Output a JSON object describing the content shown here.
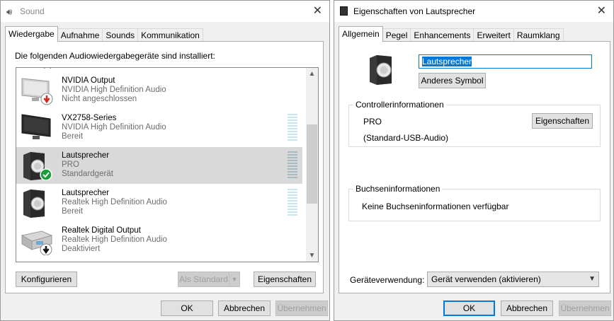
{
  "sound_window": {
    "title": "Sound",
    "tabs": [
      "Wiedergabe",
      "Aufnahme",
      "Sounds",
      "Kommunikation"
    ],
    "instruction": "Die folgenden Audiowiedergabegeräte sind installiert:",
    "devices": [
      {
        "name": "NVIDIA Output",
        "driver": "NVIDIA High Definition Audio",
        "status": "Nicht angeschlossen",
        "icon": "monitor-icon",
        "badge": "unplugged-badge-icon"
      },
      {
        "name": "VX2758-Series",
        "driver": "NVIDIA High Definition Audio",
        "status": "Bereit",
        "icon": "monitor-icon",
        "badge": ""
      },
      {
        "name": "Lautsprecher",
        "driver": "PRO",
        "status": "Standardgerät",
        "icon": "speaker-icon",
        "badge": "default-check-badge-icon"
      },
      {
        "name": "Lautsprecher",
        "driver": "Realtek High Definition Audio",
        "status": "Bereit",
        "icon": "speaker-icon",
        "badge": ""
      },
      {
        "name": "Realtek Digital Output",
        "driver": "Realtek High Definition Audio",
        "status": "Deaktiviert",
        "icon": "digital-output-icon",
        "badge": "disabled-badge-icon"
      }
    ],
    "buttons": {
      "configure": "Konfigurieren",
      "set_default": "Als Standard",
      "properties": "Eigenschaften",
      "ok": "OK",
      "cancel": "Abbrechen",
      "apply": "Übernehmen"
    }
  },
  "props_window": {
    "title": "Eigenschaften von Lautsprecher",
    "tabs": [
      "Allgemein",
      "Pegel",
      "Enhancements",
      "Erweitert",
      "Raumklang"
    ],
    "device_name": "Lautsprecher",
    "change_icon": "Anderes Symbol",
    "controller": {
      "heading": "Controllerinformationen",
      "name": "PRO",
      "detail": "(Standard-USB-Audio)",
      "properties": "Eigenschaften"
    },
    "jack": {
      "heading": "Buchseninformationen",
      "text": "Keine Buchseninformationen verfügbar"
    },
    "usage_label": "Geräteverwendung:",
    "usage_value": "Gerät verwenden (aktivieren)",
    "buttons": {
      "ok": "OK",
      "cancel": "Abbrechen",
      "apply": "Übernehmen"
    }
  },
  "colors": {
    "accent": "#0078d7",
    "selected_row": "#d9d9d9",
    "meter": "#c7e6f5",
    "check_green": "#1a9c3a",
    "unplugged_red": "#d8261f"
  }
}
